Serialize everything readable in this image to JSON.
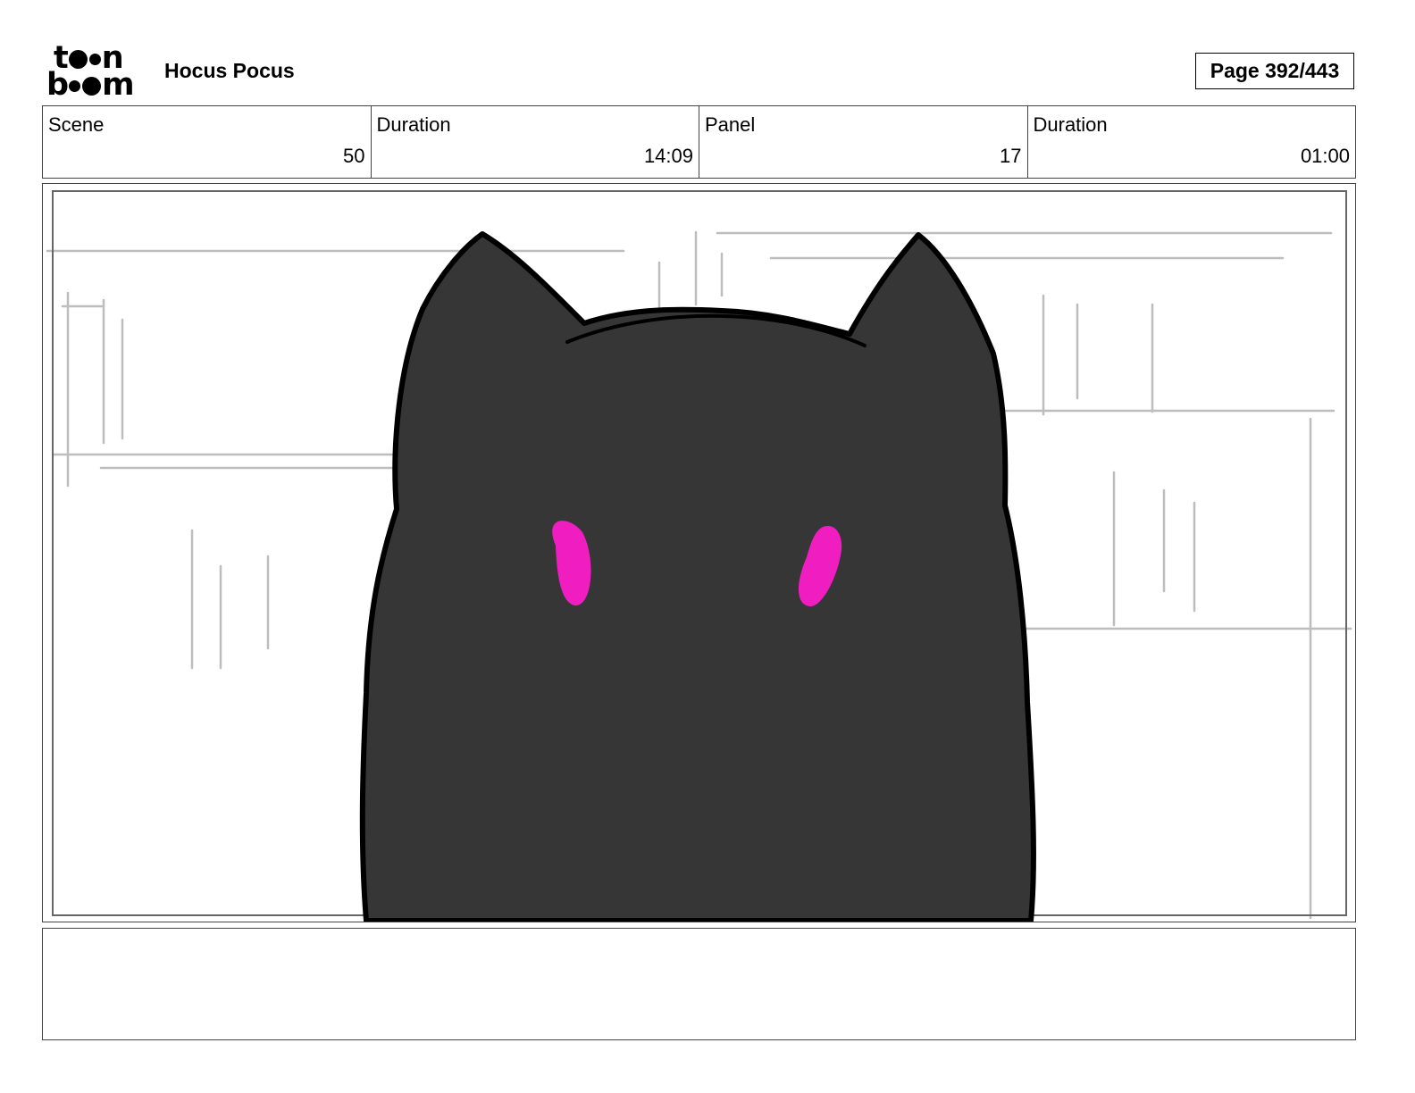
{
  "header": {
    "logo_top": "t",
    "logo_top_end": "n",
    "logo_bottom_start": "b",
    "logo_bottom_end": "m",
    "project_title": "Hocus Pocus",
    "page_label": "Page 392/443"
  },
  "info": {
    "scene_label": "Scene",
    "scene_value": "50",
    "scene_duration_label": "Duration",
    "scene_duration_value": "14:09",
    "panel_label": "Panel",
    "panel_value": "17",
    "panel_duration_label": "Duration",
    "panel_duration_value": "01:00"
  },
  "panel_art": {
    "subject": "cat-silhouette",
    "body_color": "#363636",
    "eye_color": "#f01ec0",
    "sketch_line_color": "#bdbdbd",
    "frame_color": "#666666"
  },
  "notes": {
    "text": ""
  }
}
